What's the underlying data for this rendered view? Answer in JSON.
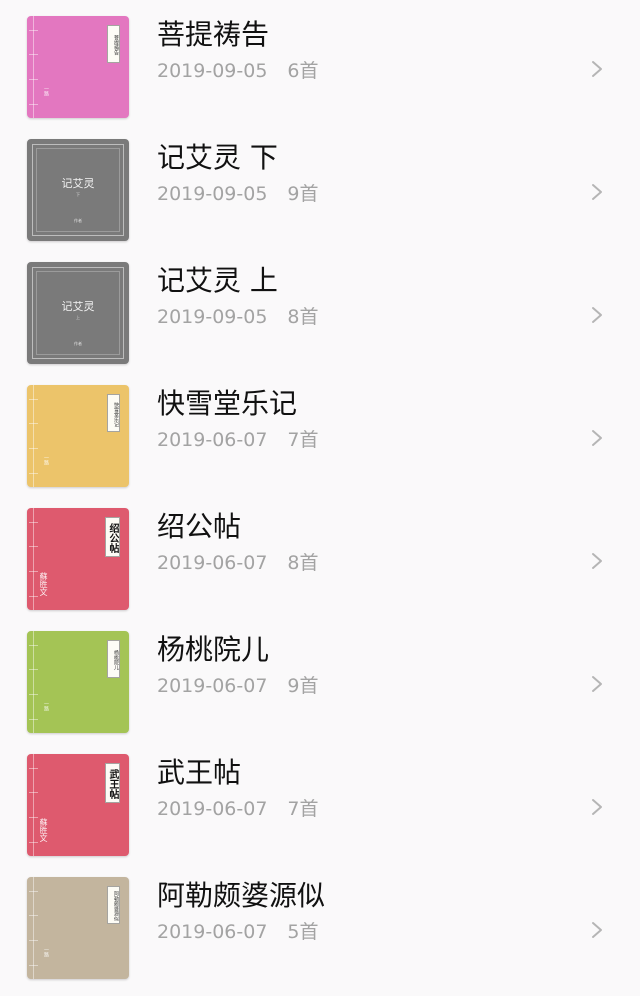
{
  "poems": [
    {
      "title": "菩提祷告",
      "date": "2019-09-05",
      "count": "6首",
      "cover": {
        "style": "thread",
        "color": "#e377c0",
        "slip_text": "菩提祷告",
        "slip_bold": false,
        "author_text": "一路",
        "author_wide": false
      }
    },
    {
      "title": "记艾灵 下",
      "date": "2019-09-05",
      "count": "9首",
      "cover": {
        "style": "framed",
        "color": "#7a7a7a",
        "center_text": "记艾灵",
        "sub_text": "下",
        "foot_text": "作者"
      }
    },
    {
      "title": "记艾灵 上",
      "date": "2019-09-05",
      "count": "8首",
      "cover": {
        "style": "framed",
        "color": "#7a7a7a",
        "center_text": "记艾灵",
        "sub_text": "上",
        "foot_text": "作者"
      }
    },
    {
      "title": "快雪堂乐记",
      "date": "2019-06-07",
      "count": "7首",
      "cover": {
        "style": "thread",
        "color": "#ecc46a",
        "slip_text": "快雪堂乐记",
        "slip_bold": false,
        "author_text": "一路",
        "author_wide": false
      }
    },
    {
      "title": "绍公帖",
      "date": "2019-06-07",
      "count": "8首",
      "cover": {
        "style": "thread",
        "color": "#de5a6e",
        "slip_text": "绍公帖",
        "slip_bold": true,
        "author_text": "蘇胜文王",
        "author_wide": true
      }
    },
    {
      "title": "杨桃院儿",
      "date": "2019-06-07",
      "count": "9首",
      "cover": {
        "style": "thread",
        "color": "#a4c455",
        "slip_text": "杨桃院儿",
        "slip_bold": false,
        "author_text": "一路",
        "author_wide": false
      }
    },
    {
      "title": "武王帖",
      "date": "2019-06-07",
      "count": "7首",
      "cover": {
        "style": "thread",
        "color": "#de5a6e",
        "slip_text": "武王帖",
        "slip_bold": true,
        "author_text": "蘇胜文王",
        "author_wide": true
      }
    },
    {
      "title": "阿勒颇婆源似",
      "date": "2019-06-07",
      "count": "5首",
      "cover": {
        "style": "thread",
        "color": "#c3b59e",
        "slip_text": "阿勒颇婆源似",
        "slip_bold": false,
        "author_text": "一路",
        "author_wide": false
      }
    }
  ]
}
